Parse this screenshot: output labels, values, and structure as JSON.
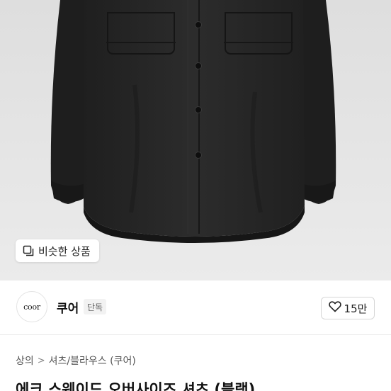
{
  "product_image": {
    "alt_icon": "shirt-product-photo"
  },
  "similar_button": {
    "label": "비슷한 상품",
    "icon": "similar-items-icon"
  },
  "brand": {
    "logo_text": "coor",
    "name": "쿠어",
    "badge": "단독"
  },
  "like": {
    "count": "15만",
    "icon": "heart-outline-icon"
  },
  "breadcrumb": {
    "items": [
      "상의",
      "셔츠/블라우스 (쿠어)"
    ],
    "separator": ">"
  },
  "product": {
    "title": "에크 스웨이드 오버사이즈 셔츠 (블랙)"
  },
  "colors": {
    "background": "#ffffff",
    "hero_bg": "#e8e8e8",
    "shirt": "#262626",
    "accent_text": "#111111"
  }
}
